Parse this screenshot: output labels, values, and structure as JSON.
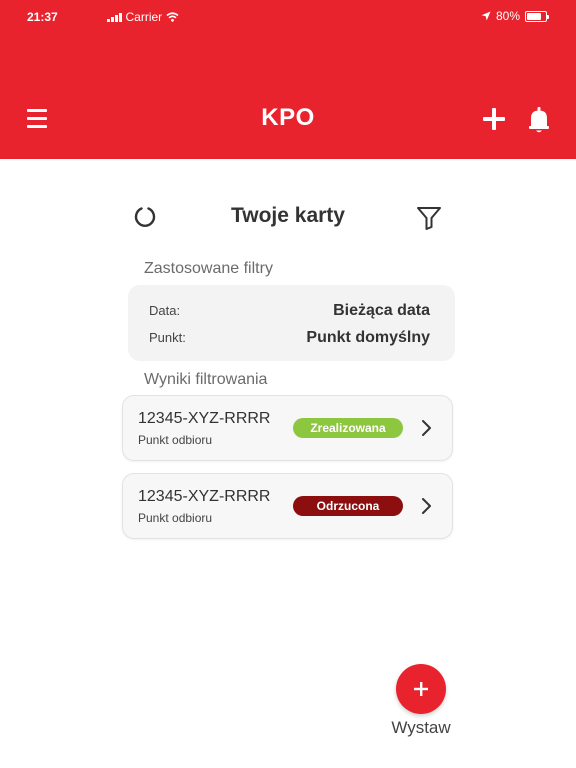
{
  "status_bar": {
    "time": "21:37",
    "carrier": "Carrier",
    "battery": "80%",
    "battery_level": 0.8
  },
  "appbar": {
    "title": "KPO",
    "menu_icon": "hamburger-menu-icon",
    "add_icon": "plus-icon",
    "notifications_icon": "bell-icon"
  },
  "content": {
    "title": "Twoje karty",
    "refresh_icon": "refresh-icon",
    "filter_icon": "filter-funnel-icon"
  },
  "filters": {
    "section_label": "Zastosowane filtry",
    "rows": [
      {
        "key": "Data:",
        "value": "Bieżąca data"
      },
      {
        "key": "Punkt:",
        "value": "Punkt domyślny"
      }
    ]
  },
  "results": {
    "section_label": "Wyniki filtrowania",
    "cards": [
      {
        "code": "12345-XYZ-RRRR",
        "subtitle": "Punkt odbioru",
        "status": "Zrealizowana",
        "status_color": "#8dc63f"
      },
      {
        "code": "12345-XYZ-RRRR",
        "subtitle": "Punkt odbioru",
        "status": "Odrzucona",
        "status_color": "#8c0e0e"
      }
    ]
  },
  "fab": {
    "label": "Wystaw",
    "icon": "plus-icon"
  },
  "colors": {
    "brand": "#e8232d",
    "card_bg": "#f7f7f7",
    "filter_bg": "#f3f3f3"
  }
}
